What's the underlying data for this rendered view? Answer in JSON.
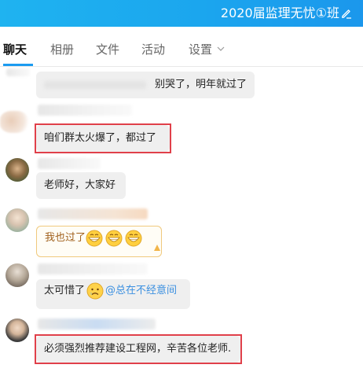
{
  "header": {
    "title": "2020届监理无忧①班",
    "icon": "edit-icon"
  },
  "tabs": [
    {
      "label": "聊天",
      "active": true
    },
    {
      "label": "相册",
      "active": false
    },
    {
      "label": "文件",
      "active": false
    },
    {
      "label": "活动",
      "active": false
    },
    {
      "label": "设置",
      "active": false,
      "icon": "chevron-down-icon"
    }
  ],
  "messages": [
    {
      "text": "别哭了，明年就过了"
    },
    {
      "text": "咱们群太火爆了，都过了"
    },
    {
      "text": "老师好，大家好"
    },
    {
      "text": "我也过了"
    },
    {
      "text": "太可惜了",
      "mention": "@总在不经意间"
    },
    {
      "text": "必须强烈推荐建设工程网，辛苦各位老师."
    }
  ],
  "colors": {
    "header_start": "#1fb3f0",
    "header_end": "#1b97ec",
    "highlight": "#e0404a",
    "mention": "#3a8fe0",
    "bubble": "#efefef"
  }
}
